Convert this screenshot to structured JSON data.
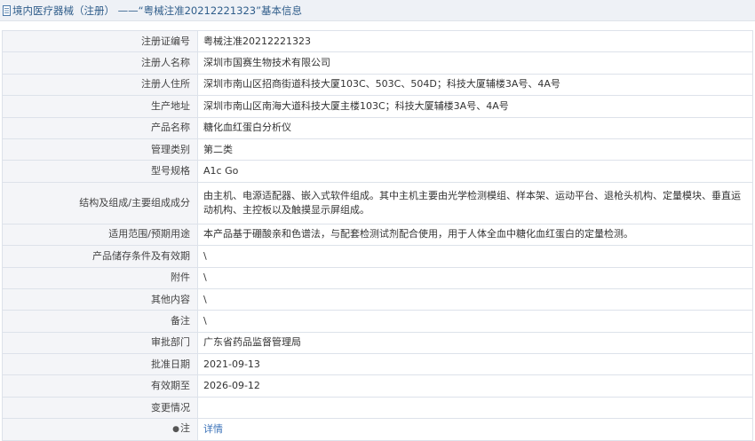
{
  "header": {
    "title": "境内医疗器械（注册） ——“粤械注准20212221323”基本信息"
  },
  "rows": [
    {
      "label": "注册证编号",
      "value": "粤械注准20212221323"
    },
    {
      "label": "注册人名称",
      "value": "深圳市国赛生物技术有限公司"
    },
    {
      "label": "注册人住所",
      "value": "深圳市南山区招商街道科技大厦103C、503C、504D；科技大厦辅楼3A号、4A号"
    },
    {
      "label": "生产地址",
      "value": "深圳市南山区南海大道科技大厦主楼103C；科技大厦辅楼3A号、4A号"
    },
    {
      "label": "产品名称",
      "value": "糖化血红蛋白分析仪"
    },
    {
      "label": "管理类别",
      "value": "第二类"
    },
    {
      "label": "型号规格",
      "value": "A1c Go"
    },
    {
      "label": "结构及组成/主要组成成分",
      "value": "由主机、电源适配器、嵌入式软件组成。其中主机主要由光学检测模组、样本架、运动平台、退枪头机构、定量模块、垂直运动机构、主控板以及触摸显示屏组成。"
    },
    {
      "label": "适用范围/预期用途",
      "value": "本产品基于硼酸亲和色谱法，与配套检测试剂配合使用，用于人体全血中糖化血红蛋白的定量检测。"
    },
    {
      "label": "产品储存条件及有效期",
      "value": "\\"
    },
    {
      "label": "附件",
      "value": "\\"
    },
    {
      "label": "其他内容",
      "value": "\\"
    },
    {
      "label": "备注",
      "value": "\\"
    },
    {
      "label": "审批部门",
      "value": "广东省药品监督管理局"
    },
    {
      "label": "批准日期",
      "value": "2021-09-13"
    },
    {
      "label": "有效期至",
      "value": "2026-09-12"
    },
    {
      "label": "变更情况",
      "value": ""
    }
  ],
  "note_row": {
    "label": "注",
    "icon": "pin-icon",
    "link_text": "详情"
  },
  "colors": {
    "header_bg": "#eef1f6",
    "title": "#2f5d8a",
    "label_bg": "#f4f5f8",
    "border": "#dde2ea",
    "link": "#3b72b8"
  }
}
